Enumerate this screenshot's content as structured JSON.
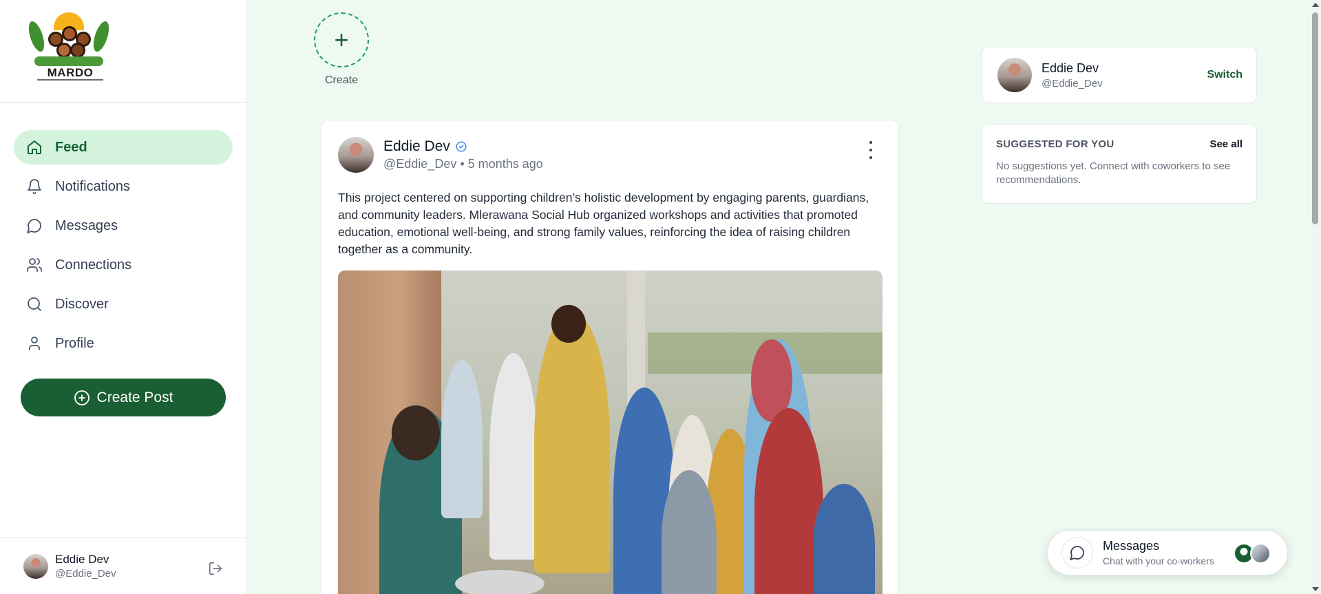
{
  "brand": {
    "name": "MARDO"
  },
  "sidebar": {
    "items": [
      {
        "label": "Feed",
        "icon": "home-icon",
        "active": true
      },
      {
        "label": "Notifications",
        "icon": "bell-icon",
        "active": false
      },
      {
        "label": "Messages",
        "icon": "chat-bubble-icon",
        "active": false
      },
      {
        "label": "Connections",
        "icon": "users-icon",
        "active": false
      },
      {
        "label": "Discover",
        "icon": "search-icon",
        "active": false
      },
      {
        "label": "Profile",
        "icon": "user-icon",
        "active": false
      }
    ],
    "create_post_label": "Create Post",
    "user": {
      "name": "Eddie Dev",
      "handle": "@Eddie_Dev"
    }
  },
  "stories": {
    "create_label": "Create"
  },
  "post": {
    "author": "Eddie Dev",
    "handle": "@Eddie_Dev",
    "time": "5 months ago",
    "text": "This project centered on supporting children’s holistic development by engaging parents, guardians, and community leaders. Mlerawana Social Hub organized workshops and activities that promoted education, emotional well-being, and strong family values, reinforcing the idea of raising children together as a community."
  },
  "account": {
    "name": "Eddie Dev",
    "handle": "@Eddie_Dev",
    "switch_label": "Switch"
  },
  "suggestions": {
    "title": "SUGGESTED FOR YOU",
    "see_all_label": "See all",
    "empty_text": "No suggestions yet. Connect with coworkers to see recommendations."
  },
  "messages_widget": {
    "title": "Messages",
    "subtitle": "Chat with your co-workers"
  },
  "colors": {
    "accent": "#1a5e33",
    "active_bg": "#d4f3dd",
    "page_bg": "#eefaf1"
  }
}
